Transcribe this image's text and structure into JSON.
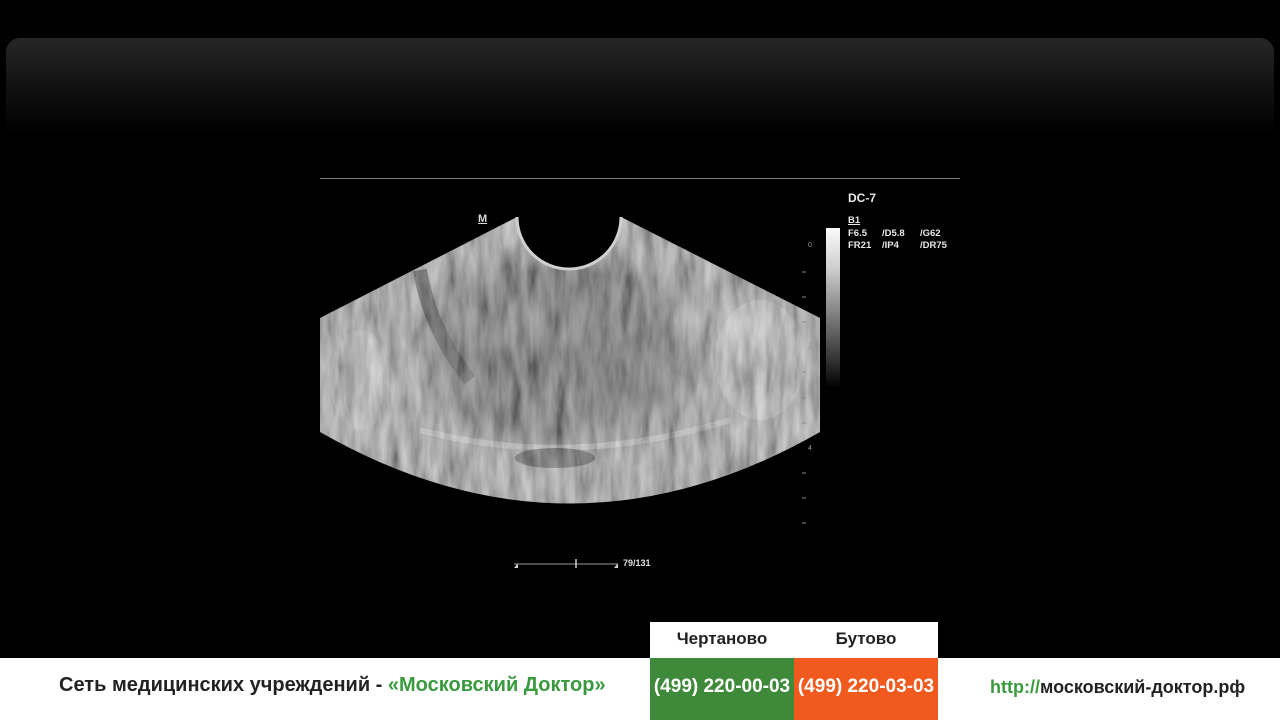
{
  "scan": {
    "orientation_marker": "M",
    "probe": "DC-7",
    "mode": "B1",
    "params_row1": [
      "F6.5",
      "/D5.8",
      "/G62"
    ],
    "params_row2": [
      "FR21",
      "/IP4",
      "/DR75"
    ],
    "depth_labels": [
      "0",
      "2",
      "4"
    ],
    "frame_counter": "79/131"
  },
  "footer": {
    "network_prefix": "Сеть медицинских учреждений - ",
    "network_brand": "«Московский Доктор»",
    "branches": [
      {
        "name": "Чертаново",
        "phone": "(499) 220-00-03",
        "color": "#3e8a3a"
      },
      {
        "name": "Бутово",
        "phone": "(499) 220-03-03",
        "color": "#f05a1f"
      }
    ],
    "url_protocol": "http://",
    "url_domain": "московский-доктор.рф"
  }
}
